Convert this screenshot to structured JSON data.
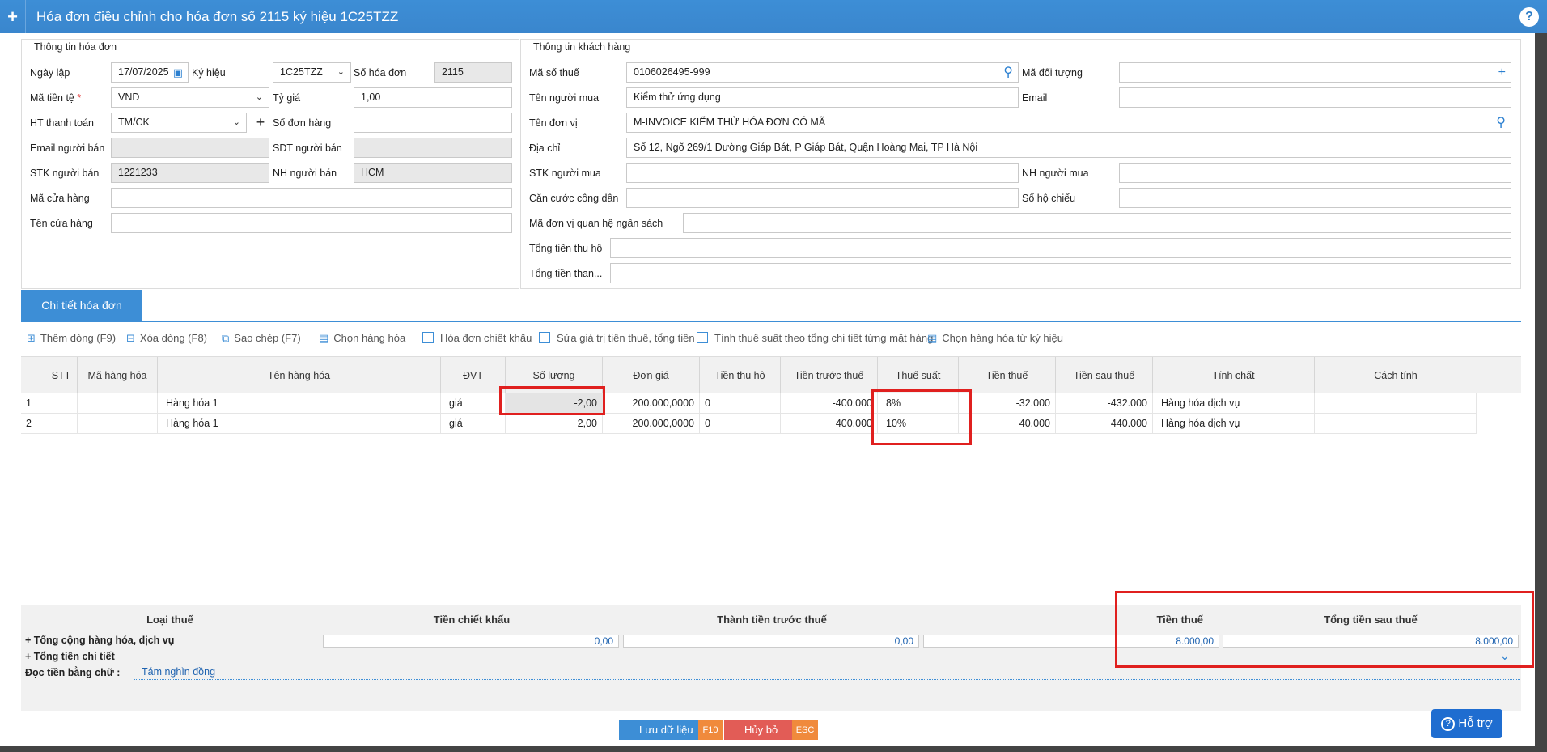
{
  "window": {
    "plus_icon": "+",
    "title": "Hóa đơn điều chỉnh cho hóa đơn số 2115 ký hiệu 1C25TZZ",
    "help_icon": "?"
  },
  "invoice_info": {
    "section_title": "Thông tin hóa đơn",
    "ngay_lap": {
      "label": "Ngày lập",
      "value": "17/07/2025"
    },
    "ky_hieu": {
      "label": "Ký hiệu",
      "value": "1C25TZZ"
    },
    "so_hoa_don": {
      "label": "Số hóa đơn",
      "value": "2115"
    },
    "ma_tien_te": {
      "label": "Mã tiền tệ",
      "required_mark": "*",
      "value": "VND"
    },
    "ty_gia": {
      "label": "Tỷ giá",
      "value": "1,00"
    },
    "ht_thanh_toan": {
      "label": "HT thanh toán",
      "value": "TM/CK",
      "add_icon": "+"
    },
    "so_don_hang": {
      "label": "Số đơn hàng",
      "value": ""
    },
    "email_nguoi_ban": {
      "label": "Email người bán",
      "value": ""
    },
    "sdt_nguoi_ban": {
      "label": "SDT người bán",
      "value": ""
    },
    "stk_nguoi_ban": {
      "label": "STK người bán",
      "value": "1221233"
    },
    "nh_nguoi_ban": {
      "label": "NH người bán",
      "value": "HCM"
    },
    "ma_cua_hang": {
      "label": "Mã cửa hàng",
      "value": ""
    },
    "ten_cua_hang": {
      "label": "Tên cửa hàng",
      "value": ""
    }
  },
  "customer_info": {
    "section_title": "Thông tin khách hàng",
    "ma_so_thue": {
      "label": "Mã số thuế",
      "value": "0106026495-999"
    },
    "ma_doi_tuong": {
      "label": "Mã đối tượng",
      "value": "",
      "add_icon": "+"
    },
    "ten_nguoi_mua": {
      "label": "Tên người mua",
      "value": "Kiểm thử ứng dụng"
    },
    "email": {
      "label": "Email",
      "value": ""
    },
    "ten_don_vi": {
      "label": "Tên đơn vị",
      "value": "M-INVOICE KIỂM THỬ HÓA ĐƠN CÓ MÃ"
    },
    "dia_chi": {
      "label": "Địa chỉ",
      "value": "Số 12, Ngõ 269/1 Đường Giáp Bát, P Giáp Bát, Quận Hoàng Mai, TP Hà Nội"
    },
    "stk_nguoi_mua": {
      "label": "STK người mua",
      "value": ""
    },
    "nh_nguoi_mua": {
      "label": "NH người mua",
      "value": ""
    },
    "can_cuoc": {
      "label": "Căn cước công dân",
      "value": ""
    },
    "so_ho_chieu": {
      "label": "Số hộ chiếu",
      "value": ""
    },
    "ma_don_vi_qhns": {
      "label": "Mã đơn vị quan hệ ngân sách",
      "value": ""
    },
    "tong_tien_thu_ho": {
      "label": "Tổng tiền thu hộ",
      "value": ""
    },
    "tong_tien_than": {
      "label": "Tổng tiền than...",
      "value": ""
    }
  },
  "detail_tab": {
    "label": "Chi tiết hóa đơn"
  },
  "toolbar": {
    "them_dong": "Thêm dòng (F9)",
    "xoa_dong": "Xóa dòng (F8)",
    "sao_chep": "Sao chép (F7)",
    "chon_hang_hoa": "Chọn hàng hóa",
    "hoa_don_chiet_khau": "Hóa đơn chiết khấu",
    "sua_gia_tri": "Sửa giá trị tiền thuế, tổng tiền",
    "tinh_thue_suat": "Tính thuế suất theo tổng chi tiết từng mặt hàng",
    "chon_tu_ky_hieu": "Chọn hàng hóa từ ký hiệu"
  },
  "grid": {
    "headers": [
      "STT",
      "Mã hàng hóa",
      "Tên hàng hóa",
      "ĐVT",
      "Số lượng",
      "Đơn giá",
      "Tiền thu hộ",
      "Tiền trước thuế",
      "Thuế suất",
      "Tiền thuế",
      "Tiền sau thuế",
      "Tính chất",
      "Cách tính"
    ],
    "rows": [
      {
        "no": "1",
        "stt": "",
        "ma": "",
        "ten": "Hàng hóa 1",
        "dvt": "giá",
        "so_luong": "-2,00",
        "don_gia": "200.000,0000",
        "thu_ho": "0",
        "truoc_thue": "-400.000",
        "thue_suat": "8%",
        "tien_thue": "-32.000",
        "sau_thue": "-432.000",
        "tinh_chat": "Hàng hóa dịch vụ",
        "cach_tinh": ""
      },
      {
        "no": "2",
        "stt": "",
        "ma": "",
        "ten": "Hàng hóa 1",
        "dvt": "giá",
        "so_luong": "2,00",
        "don_gia": "200.000,0000",
        "thu_ho": "0",
        "truoc_thue": "400.000",
        "thue_suat": "10%",
        "tien_thue": "40.000",
        "sau_thue": "440.000",
        "tinh_chat": "Hàng hóa dịch vụ",
        "cach_tinh": ""
      }
    ]
  },
  "summary": {
    "headers": [
      "Loại thuế",
      "Tiền chiết khấu",
      "Thành tiền trước thuế",
      "Tiền thuế",
      "Tổng tiền sau thuế"
    ],
    "tong_cong_label": "+ Tổng cộng hàng hóa, dịch vụ",
    "tien_chiet_khau": "0,00",
    "thanh_tien_truoc_thue": "0,00",
    "tien_thue": "8.000,00",
    "tong_tien_sau_thue": "8.000,00",
    "tong_tien_chi_tiet_label": "+ Tổng tiền chi tiết",
    "doc_tien_label": "Đọc tiền bằng chữ :",
    "doc_tien_value": "Tám nghìn đồng"
  },
  "actions": {
    "save": "Lưu dữ liệu",
    "save_key": "F10",
    "cancel": "Hủy bỏ",
    "cancel_key": "ESC",
    "support": "Hỗ trợ"
  },
  "colors": {
    "primary": "#3d8ed6",
    "highlight_red": "#e0201f"
  }
}
